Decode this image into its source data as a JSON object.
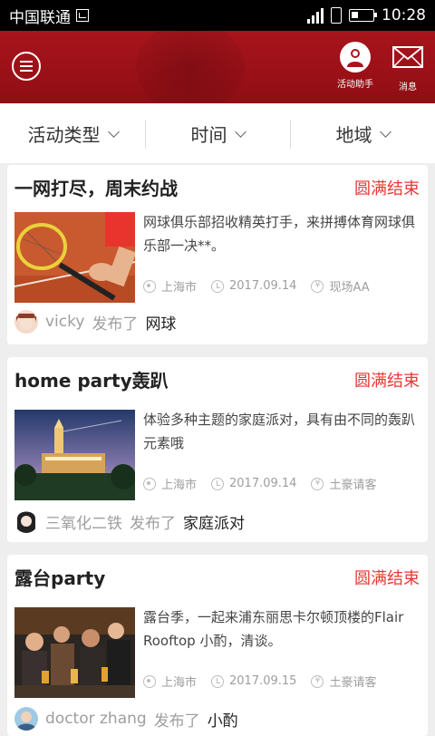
{
  "status_bar": {
    "carrier": "中国联通",
    "time": "10:28"
  },
  "header": {
    "assistant_label": "活动助手",
    "messages_label": "消息"
  },
  "filters": [
    {
      "label": "活动类型"
    },
    {
      "label": "时间"
    },
    {
      "label": "地域"
    }
  ],
  "cards": [
    {
      "title": "一网打尽，周末约战",
      "status": "圆满结束",
      "description": "网球俱乐部招收精英打手，来拼搏体育网球俱乐部一决**。",
      "location": "上海市",
      "date": "2017.09.14",
      "fee": "现场AA",
      "user": "vicky",
      "verb": "发布了",
      "tag": "网球"
    },
    {
      "title": "home party轰趴",
      "status": "圆满结束",
      "description": "体验多种主题的家庭派对，具有由不同的轰趴元素哦",
      "location": "上海市",
      "date": "2017.09.14",
      "fee": "土豪请客",
      "user": "三氧化二铁",
      "verb": "发布了",
      "tag": "家庭派对"
    },
    {
      "title": "露台party",
      "status": "圆满结束",
      "description": "露台季，一起来浦东丽思卡尔顿顶楼的Flair Rooftop 小酌，清谈。",
      "location": "上海市",
      "date": "2017.09.15",
      "fee": "土豪请客",
      "user": "doctor zhang",
      "verb": "发布了",
      "tag": "小酌"
    }
  ]
}
